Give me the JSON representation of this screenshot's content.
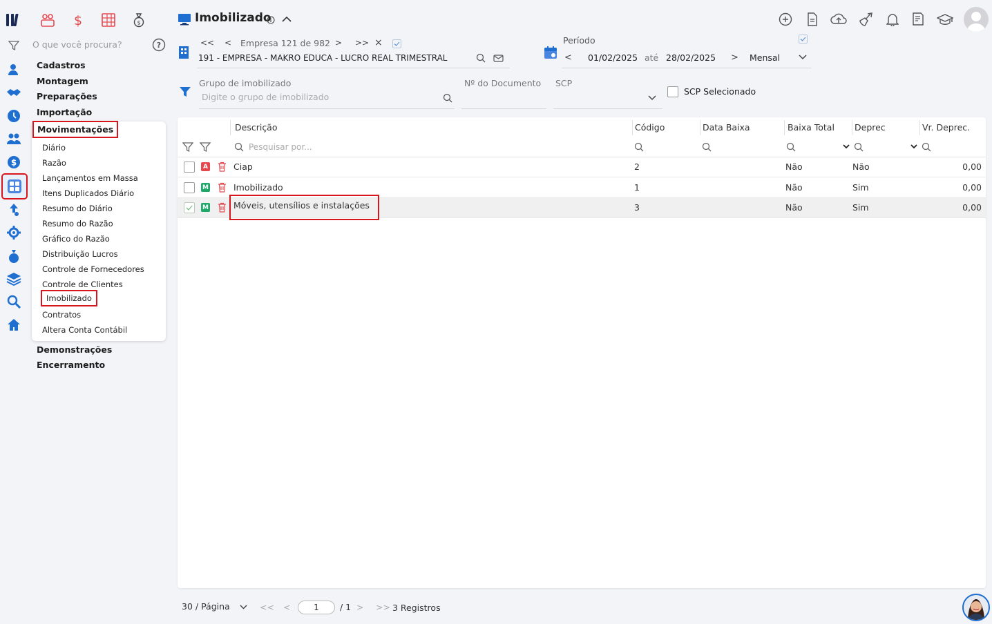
{
  "sidebar": {
    "search_placeholder": "O que você procura?",
    "categories_top": [
      "Cadastros",
      "Montagem",
      "Preparações",
      "Importação"
    ],
    "active_category": "Movimentações",
    "sub_items": [
      "Diário",
      "Razão",
      "Lançamentos em Massa",
      "Itens Duplicados Diário",
      "Resumo do Diário",
      "Resumo do Razão",
      "Gráfico do Razão",
      "Distribuição Lucros",
      "Controle de Fornecedores",
      "Controle de Clientes",
      "Imobilizado",
      "Contratos",
      "Altera Conta Contábil"
    ],
    "categories_bottom": [
      "Demonstrações",
      "Encerramento"
    ]
  },
  "header": {
    "title": "Imobilizado",
    "company_nav": "Empresa 121 de 982",
    "company_name": "191 - EMPRESA - MAKRO EDUCA - LUCRO REAL TRIMESTRAL",
    "period_label": "Período",
    "date_from": "01/02/2025",
    "date_sep": "até",
    "date_to": "28/02/2025",
    "period_type": "Mensal"
  },
  "filters": {
    "group_label": "Grupo de imobilizado",
    "group_placeholder": "Digite o grupo de imobilizado",
    "doc_label": "Nº do Documento",
    "scp_label": "SCP",
    "scp_selected_label": "SCP Selecionado"
  },
  "table": {
    "columns": [
      "Descrição",
      "Código",
      "Data Baixa",
      "Baixa Total",
      "Deprec",
      "Vr. Deprec."
    ],
    "search_placeholder": "Pesquisar por...",
    "rows": [
      {
        "badge": "A",
        "badge_color": "#e5484d",
        "descricao": "Ciap",
        "codigo": "2",
        "data_baixa": "",
        "baixa_total": "Não",
        "deprec": "Não",
        "vr_deprec": "0,00",
        "checked": false
      },
      {
        "badge": "M",
        "badge_color": "#1fa86a",
        "descricao": "Imobilizado",
        "codigo": "1",
        "data_baixa": "",
        "baixa_total": "Não",
        "deprec": "Sim",
        "vr_deprec": "0,00",
        "checked": false
      },
      {
        "badge": "M",
        "badge_color": "#1fa86a",
        "descricao": "Móveis, utensílios e instalações",
        "codigo": "3",
        "data_baixa": "",
        "baixa_total": "Não",
        "deprec": "Sim",
        "vr_deprec": "0,00",
        "checked": true
      }
    ]
  },
  "footer": {
    "per_page": "30 / Página",
    "page_value": "1",
    "page_total": "/ 1",
    "records": "3 Registros"
  },
  "colors": {
    "accent": "#1a73c8",
    "highlight": "#d8141c",
    "nav_icon": "#1f6fd1"
  }
}
